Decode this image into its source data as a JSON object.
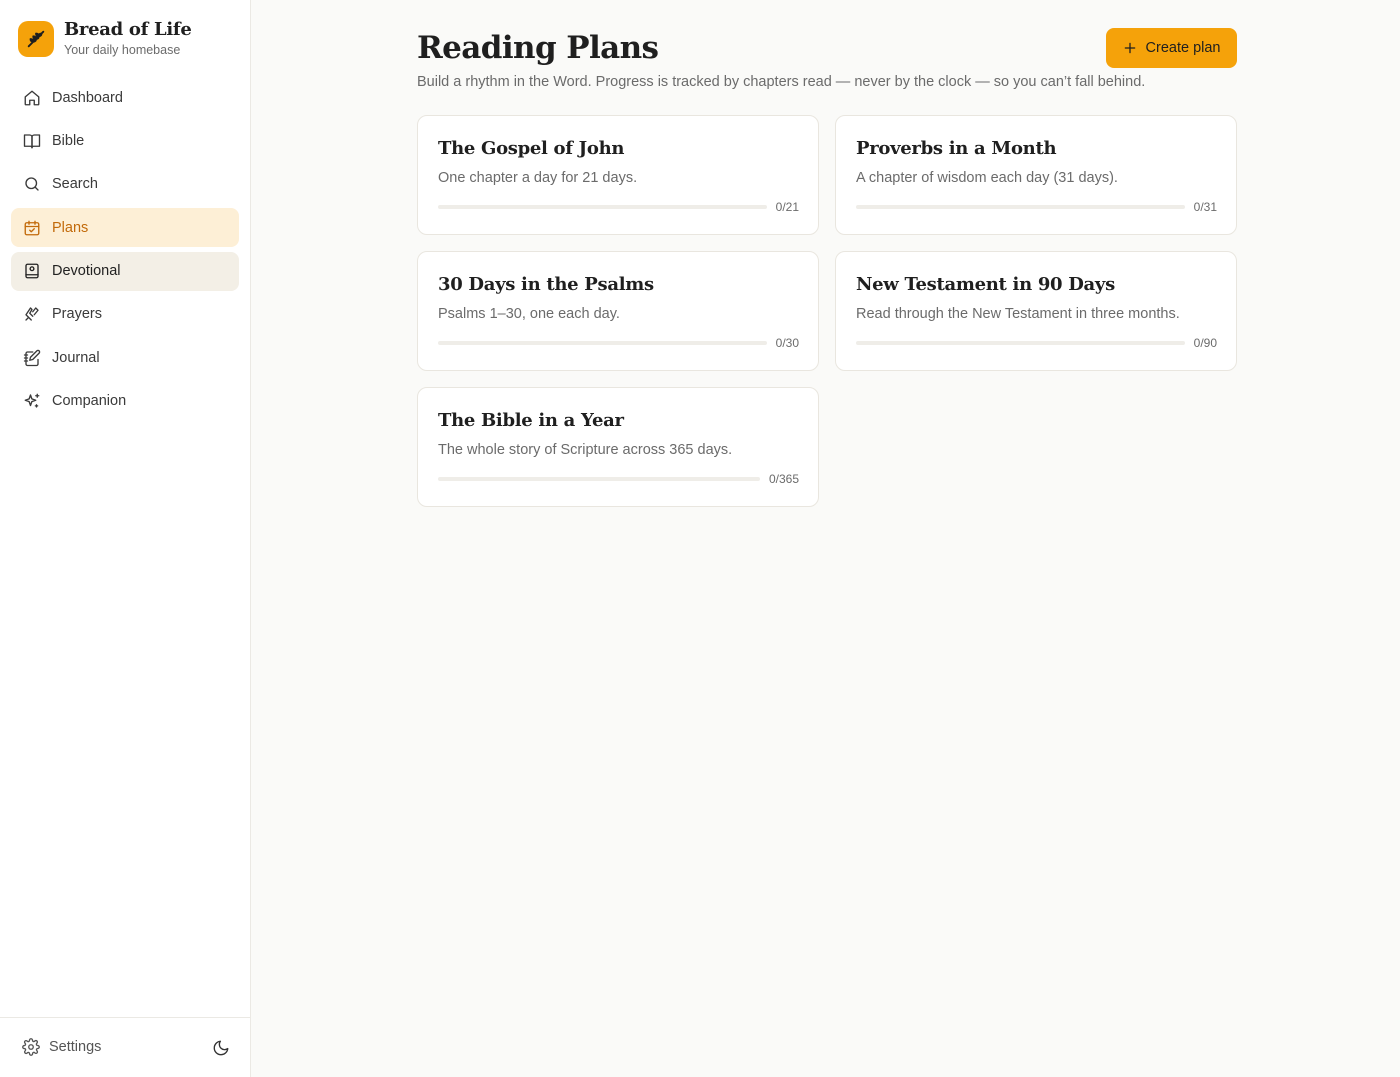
{
  "brand": {
    "name": "Bread of Life",
    "tagline": "Your daily homebase",
    "accent": "#f5a20a"
  },
  "sidebar": {
    "items": [
      {
        "label": "Dashboard",
        "icon": "home-icon",
        "state": "default"
      },
      {
        "label": "Bible",
        "icon": "book-open-icon",
        "state": "default"
      },
      {
        "label": "Search",
        "icon": "search-icon",
        "state": "default"
      },
      {
        "label": "Plans",
        "icon": "calendar-check-icon",
        "state": "active"
      },
      {
        "label": "Devotional",
        "icon": "book-bookmark-icon",
        "state": "hover"
      },
      {
        "label": "Prayers",
        "icon": "praying-hands-icon",
        "state": "default"
      },
      {
        "label": "Journal",
        "icon": "notebook-pen-icon",
        "state": "default"
      },
      {
        "label": "Companion",
        "icon": "sparkles-icon",
        "state": "default"
      }
    ],
    "footer": {
      "settings_label": "Settings",
      "settings_icon": "gear-icon",
      "theme_icon": "moon-icon"
    }
  },
  "main": {
    "title": "Reading Plans",
    "subtitle": "Build a rhythm in the Word. Progress is tracked by chapters read — never by the clock — so you can’t fall behind.",
    "create_button": {
      "label": "Create plan",
      "icon": "plus-icon"
    },
    "plans": [
      {
        "title": "The Gospel of John",
        "description": "One chapter a day for 21 days.",
        "completed": 0,
        "total": 21,
        "count_label": "0/21"
      },
      {
        "title": "Proverbs in a Month",
        "description": "A chapter of wisdom each day (31 days).",
        "completed": 0,
        "total": 31,
        "count_label": "0/31"
      },
      {
        "title": "30 Days in the Psalms",
        "description": "Psalms 1–30, one each day.",
        "completed": 0,
        "total": 30,
        "count_label": "0/30"
      },
      {
        "title": "New Testament in 90 Days",
        "description": "Read through the New Testament in three months.",
        "completed": 0,
        "total": 90,
        "count_label": "0/90"
      },
      {
        "title": "The Bible in a Year",
        "description": "The whole story of Scripture across 365 days.",
        "completed": 0,
        "total": 365,
        "count_label": "0/365"
      }
    ]
  }
}
